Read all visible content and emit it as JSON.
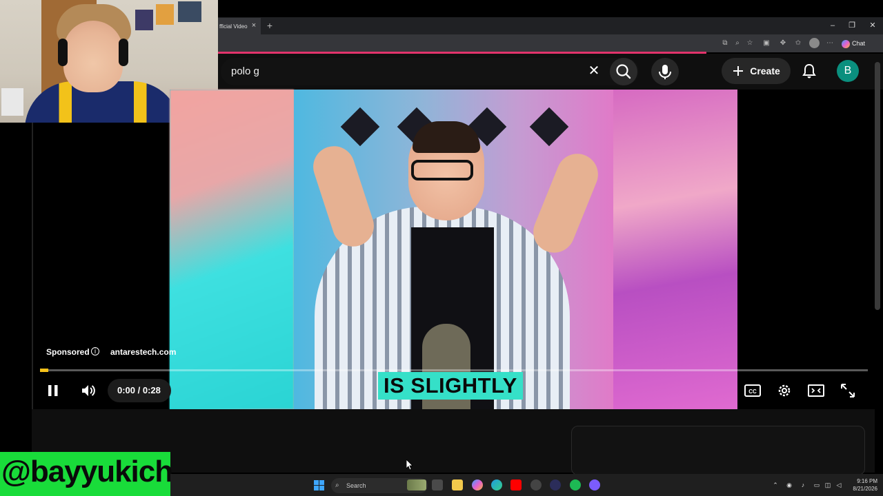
{
  "browser": {
    "tab_title": "fficial Video",
    "tab_close": "×",
    "new_tab": "+",
    "window_buttons": [
      "–",
      "❐",
      "✕"
    ],
    "toolbar_chat": "Chat"
  },
  "youtube": {
    "search_query": "polo g",
    "clear_symbol": "✕",
    "create_label": "Create",
    "avatar_letter": "B"
  },
  "player": {
    "caption": "IS SLIGHTLY",
    "sponsored_label": "Sponsored",
    "info_symbol": "i",
    "sponsor_domain": "antarestech.com",
    "time": "0:00 / 0:28",
    "progress_fraction": 0.01
  },
  "overlay": {
    "handle": "@bayyukich"
  },
  "taskbar": {
    "search_label": "Search",
    "clock_time": "9:16 PM",
    "clock_date": "8/21/2026"
  },
  "colors": {
    "accent_red": "#e2336b",
    "progress_yellow": "#f6c21a",
    "caption_bg": "#35e0c8",
    "handle_bg": "#19dc3a",
    "avatar_bg": "#0a8f7e"
  }
}
